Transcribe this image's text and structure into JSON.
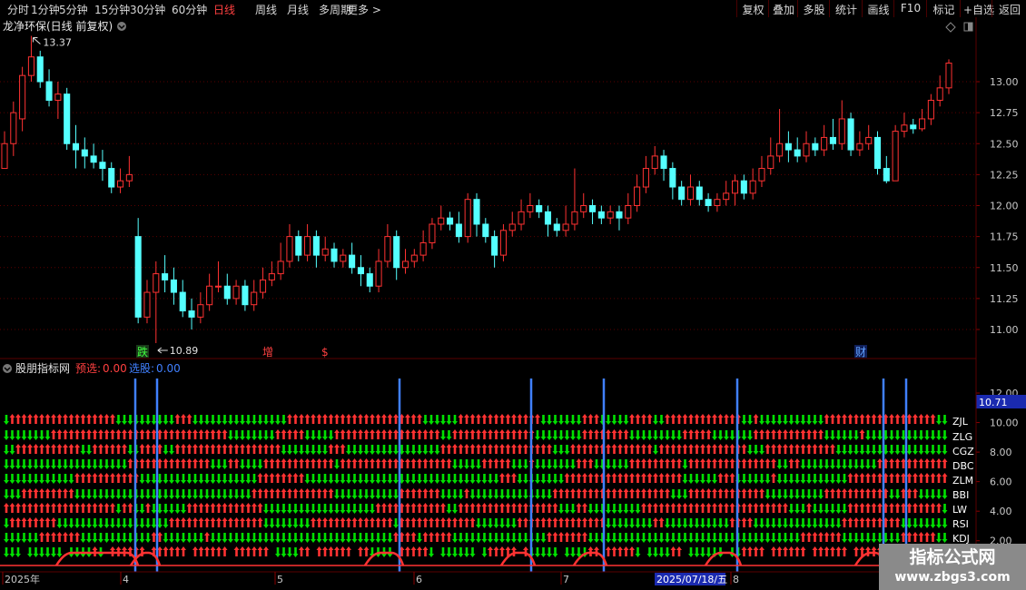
{
  "toolbar": {
    "periods": [
      "分时",
      "1分钟",
      "5分钟",
      "15分钟",
      "30分钟",
      "60分钟",
      "日线",
      "周线",
      "月线",
      "多周期",
      "更多 >"
    ],
    "active_period": "日线",
    "actions": [
      "复权",
      "叠加",
      "多股",
      "统计",
      "画线",
      "F10",
      "标记",
      "+自选",
      "返回"
    ]
  },
  "main_chart": {
    "title": "龙净环保(日线 前复权)",
    "high_label": "13.37",
    "low_label": "10.89",
    "y_ticks": [
      "13.00",
      "12.75",
      "12.50",
      "12.25",
      "12.00",
      "11.75",
      "11.50",
      "11.25",
      "11.00"
    ],
    "y_range": [
      10.85,
      13.45
    ],
    "markers": [
      {
        "label": "跌",
        "color": "#40ff40",
        "bg": "#1a3a1a"
      },
      {
        "label": "增",
        "color": "#ff4040",
        "bg": "#000"
      },
      {
        "label": "$",
        "color": "#ff4040",
        "bg": "#000"
      },
      {
        "label": "财",
        "color": "#60a0ff",
        "bg": "#10205a"
      }
    ]
  },
  "indicator_panel": {
    "title": "股朋指标网",
    "presel_label": "预选:",
    "presel_value": "0.00",
    "select_label": "选股:",
    "select_value": "0.00",
    "current_value": "10.71",
    "y_ticks": [
      "12.00",
      "10.00",
      "8.00",
      "6.00",
      "4.00",
      "2.00"
    ],
    "row_labels": [
      "ZJL",
      "ZLG",
      "CGZ",
      "DBC",
      "ZLM",
      "BBI",
      "LW",
      "RSI",
      "KDJ"
    ]
  },
  "time_axis": {
    "labels": [
      "2025年",
      "4",
      "5",
      "6",
      "7",
      "8"
    ],
    "cursor_date": "2025/07/18/五"
  },
  "watermark": {
    "title": "指标公式网",
    "url": "www.zbgs3.com"
  },
  "colors": {
    "up": "#ff3232",
    "down": "#54ffff",
    "green": "#00e000",
    "vline": "#4080ff",
    "grid": "#5a0000",
    "axis_text": "#c8c8c8"
  },
  "chart_data": {
    "type": "candlestick",
    "title": "龙净环保(日线 前复权)",
    "series": [
      {
        "values": [
          [
            12.3,
            12.5,
            12.6,
            12.38
          ],
          [
            12.5,
            12.75,
            12.84,
            12.4
          ],
          [
            12.7,
            13.05,
            13.12,
            12.6
          ],
          [
            13.05,
            13.2,
            13.37,
            13.0
          ],
          [
            13.2,
            13.0,
            13.25,
            12.95
          ],
          [
            13.0,
            12.85,
            13.1,
            12.8
          ],
          [
            12.85,
            12.9,
            13.0,
            12.7
          ],
          [
            12.9,
            12.5,
            12.95,
            12.45
          ],
          [
            12.5,
            12.45,
            12.65,
            12.3
          ],
          [
            12.45,
            12.4,
            12.55,
            12.3
          ],
          [
            12.4,
            12.35,
            12.5,
            12.3
          ],
          [
            12.35,
            12.3,
            12.45,
            12.2
          ],
          [
            12.3,
            12.15,
            12.35,
            12.1
          ],
          [
            12.15,
            12.2,
            12.3,
            12.1
          ],
          [
            12.2,
            12.25,
            12.4,
            12.15
          ],
          [
            11.75,
            11.1,
            11.9,
            11.05
          ],
          [
            11.1,
            11.3,
            11.4,
            11.05
          ],
          [
            11.3,
            11.45,
            11.55,
            10.89
          ],
          [
            11.45,
            11.4,
            11.6,
            11.3
          ],
          [
            11.4,
            11.3,
            11.5,
            11.2
          ],
          [
            11.3,
            11.15,
            11.4,
            11.1
          ],
          [
            11.15,
            11.1,
            11.25,
            11.0
          ],
          [
            11.1,
            11.2,
            11.3,
            11.05
          ],
          [
            11.2,
            11.35,
            11.45,
            11.15
          ],
          [
            11.35,
            11.35,
            11.55,
            11.3
          ],
          [
            11.35,
            11.25,
            11.45,
            11.2
          ],
          [
            11.25,
            11.35,
            11.4,
            11.2
          ],
          [
            11.35,
            11.2,
            11.4,
            11.15
          ],
          [
            11.2,
            11.3,
            11.4,
            11.15
          ],
          [
            11.3,
            11.4,
            11.5,
            11.25
          ],
          [
            11.4,
            11.45,
            11.55,
            11.35
          ],
          [
            11.45,
            11.55,
            11.7,
            11.4
          ],
          [
            11.55,
            11.75,
            11.85,
            11.5
          ],
          [
            11.75,
            11.6,
            11.8,
            11.55
          ],
          [
            11.6,
            11.75,
            11.85,
            11.55
          ],
          [
            11.75,
            11.6,
            11.8,
            11.5
          ],
          [
            11.6,
            11.65,
            11.75,
            11.55
          ],
          [
            11.65,
            11.55,
            11.7,
            11.5
          ],
          [
            11.55,
            11.6,
            11.65,
            11.5
          ],
          [
            11.6,
            11.5,
            11.7,
            11.45
          ],
          [
            11.5,
            11.45,
            11.6,
            11.35
          ],
          [
            11.45,
            11.35,
            11.5,
            11.3
          ],
          [
            11.35,
            11.55,
            11.65,
            11.3
          ],
          [
            11.55,
            11.75,
            11.85,
            11.5
          ],
          [
            11.75,
            11.5,
            11.8,
            11.4
          ],
          [
            11.5,
            11.55,
            11.65,
            11.45
          ],
          [
            11.55,
            11.6,
            11.65,
            11.5
          ],
          [
            11.6,
            11.7,
            11.8,
            11.55
          ],
          [
            11.7,
            11.85,
            11.9,
            11.65
          ],
          [
            11.85,
            11.9,
            12.0,
            11.8
          ],
          [
            11.9,
            11.85,
            11.95,
            11.8
          ],
          [
            11.85,
            11.75,
            11.95,
            11.7
          ],
          [
            11.75,
            12.05,
            12.1,
            11.7
          ],
          [
            12.05,
            11.85,
            12.1,
            11.75
          ],
          [
            11.85,
            11.75,
            11.9,
            11.7
          ],
          [
            11.75,
            11.6,
            11.8,
            11.5
          ],
          [
            11.6,
            11.8,
            11.85,
            11.55
          ],
          [
            11.8,
            11.85,
            11.95,
            11.75
          ],
          [
            11.85,
            11.95,
            12.05,
            11.8
          ],
          [
            11.95,
            12.0,
            12.1,
            11.9
          ],
          [
            12.0,
            11.95,
            12.05,
            11.9
          ],
          [
            11.95,
            11.85,
            12.0,
            11.75
          ],
          [
            11.85,
            11.8,
            11.9,
            11.75
          ],
          [
            11.8,
            11.85,
            12.0,
            11.75
          ],
          [
            11.85,
            11.95,
            12.3,
            11.8
          ],
          [
            11.95,
            12.0,
            12.1,
            11.9
          ],
          [
            12.0,
            11.95,
            12.05,
            11.85
          ],
          [
            11.95,
            11.9,
            12.0,
            11.85
          ],
          [
            11.9,
            11.95,
            12.0,
            11.85
          ],
          [
            11.95,
            11.9,
            12.0,
            11.8
          ],
          [
            11.9,
            12.0,
            12.1,
            11.85
          ],
          [
            12.0,
            12.15,
            12.25,
            11.95
          ],
          [
            12.15,
            12.3,
            12.4,
            12.1
          ],
          [
            12.3,
            12.4,
            12.48,
            12.25
          ],
          [
            12.4,
            12.3,
            12.45,
            12.2
          ],
          [
            12.3,
            12.15,
            12.35,
            12.05
          ],
          [
            12.15,
            12.05,
            12.2,
            12.0
          ],
          [
            12.05,
            12.15,
            12.25,
            12.0
          ],
          [
            12.15,
            12.05,
            12.2,
            12.0
          ],
          [
            12.05,
            12.0,
            12.1,
            11.95
          ],
          [
            12.0,
            12.05,
            12.1,
            11.95
          ],
          [
            12.05,
            12.1,
            12.2,
            12.0
          ],
          [
            12.1,
            12.2,
            12.25,
            12.0
          ],
          [
            12.2,
            12.1,
            12.25,
            12.05
          ],
          [
            12.1,
            12.2,
            12.3,
            12.05
          ],
          [
            12.2,
            12.3,
            12.4,
            12.15
          ],
          [
            12.3,
            12.4,
            12.55,
            12.25
          ],
          [
            12.4,
            12.5,
            12.78,
            12.35
          ],
          [
            12.5,
            12.45,
            12.6,
            12.35
          ],
          [
            12.45,
            12.4,
            12.55,
            12.35
          ],
          [
            12.4,
            12.5,
            12.6,
            12.35
          ],
          [
            12.5,
            12.45,
            12.55,
            12.4
          ],
          [
            12.45,
            12.55,
            12.65,
            12.4
          ],
          [
            12.55,
            12.5,
            12.7,
            12.45
          ],
          [
            12.5,
            12.7,
            12.85,
            12.45
          ],
          [
            12.7,
            12.45,
            12.75,
            12.4
          ],
          [
            12.45,
            12.5,
            12.6,
            12.4
          ],
          [
            12.5,
            12.55,
            12.65,
            12.45
          ],
          [
            12.55,
            12.3,
            12.6,
            12.25
          ],
          [
            12.3,
            12.2,
            12.4,
            12.18
          ],
          [
            12.2,
            12.6,
            12.65,
            12.2
          ],
          [
            12.6,
            12.65,
            12.75,
            12.55
          ],
          [
            12.65,
            12.62,
            12.7,
            12.58
          ],
          [
            12.62,
            12.7,
            12.78,
            12.6
          ],
          [
            12.7,
            12.85,
            12.9,
            12.65
          ],
          [
            12.85,
            12.95,
            13.05,
            12.8
          ],
          [
            12.95,
            13.15,
            13.18,
            12.9
          ]
        ]
      }
    ]
  }
}
